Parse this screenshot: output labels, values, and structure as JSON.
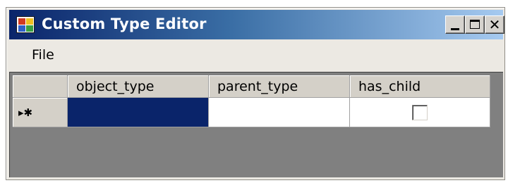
{
  "window": {
    "title": "Custom Type Editor",
    "icon": "app-grid-icon",
    "controls": [
      "minimize-icon",
      "maximize-icon",
      "close-icon"
    ],
    "close_glyph": "✕"
  },
  "menu": {
    "items": [
      {
        "label": "File"
      }
    ]
  },
  "grid": {
    "columns": [
      {
        "label": "object_type"
      },
      {
        "label": "parent_type"
      },
      {
        "label": "has_child"
      }
    ],
    "new_row": {
      "indicator": "▸✱",
      "object_type": "",
      "parent_type": "",
      "has_child": false
    }
  },
  "colors": {
    "selection": "#0a246a",
    "title_gradient_start": "#0a246a",
    "grid_background": "#808080"
  }
}
